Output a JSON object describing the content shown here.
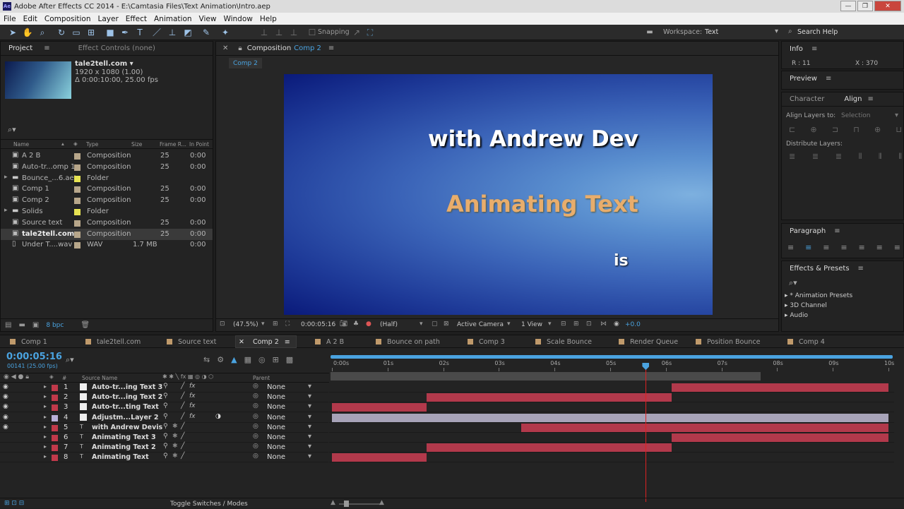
{
  "window": {
    "title": "Adobe After Effects CC 2014 - E:\\Camtasia Files\\Text Animation\\Intro.aep",
    "app_icon": "Ae"
  },
  "menu": [
    "File",
    "Edit",
    "Composition",
    "Layer",
    "Effect",
    "Animation",
    "View",
    "Window",
    "Help"
  ],
  "toolbar": {
    "snapping": "Snapping",
    "workspace_label": "Workspace:",
    "workspace_value": "Text",
    "search_placeholder": "Search Help"
  },
  "project": {
    "tab_project": "Project",
    "tab_effects": "Effect Controls (none)",
    "preview_name": "tale2tell.com ▾",
    "preview_res": "1920 x 1080 (1.00)",
    "preview_dur": "Δ 0:00:10:00, 25.00 fps",
    "columns": [
      "Name",
      "Type",
      "Size",
      "Frame R...",
      "In Point"
    ],
    "items": [
      {
        "name": "A 2 B",
        "type": "Composition",
        "size": "",
        "fr": "25",
        "in": "0:00",
        "color": "#b7a68a",
        "icon": "comp"
      },
      {
        "name": "Auto-tr...omp 1",
        "type": "Composition",
        "size": "",
        "fr": "25",
        "in": "0:00",
        "color": "#b7a68a",
        "icon": "comp"
      },
      {
        "name": "Bounce_...6.aet",
        "type": "Folder",
        "size": "",
        "fr": "",
        "in": "",
        "color": "#e7e353",
        "icon": "folder"
      },
      {
        "name": "Comp 1",
        "type": "Composition",
        "size": "",
        "fr": "25",
        "in": "0:00",
        "color": "#b7a68a",
        "icon": "comp"
      },
      {
        "name": "Comp 2",
        "type": "Composition",
        "size": "",
        "fr": "25",
        "in": "0:00",
        "color": "#b7a68a",
        "icon": "comp"
      },
      {
        "name": "Solids",
        "type": "Folder",
        "size": "",
        "fr": "",
        "in": "",
        "color": "#e7e353",
        "icon": "folder"
      },
      {
        "name": "Source text",
        "type": "Composition",
        "size": "",
        "fr": "25",
        "in": "0:00",
        "color": "#b7a68a",
        "icon": "comp"
      },
      {
        "name": "tale2tell.com",
        "type": "Composition",
        "size": "",
        "fr": "25",
        "in": "0:00",
        "color": "#b7a68a",
        "icon": "comp"
      },
      {
        "name": "Under T....wav",
        "type": "WAV",
        "size": "1.7 MB",
        "fr": "",
        "in": "0:00",
        "color": "#b7a68a",
        "icon": "audio"
      }
    ],
    "bpc": "8 bpc"
  },
  "composition": {
    "tab_label": "Composition",
    "tab_comp": "Comp 2",
    "sub_tab": "Comp 2",
    "text_line1": "with Andrew Dev",
    "text_line2": "Animating Text",
    "text_line3": "is",
    "zoom": "(47.5%)",
    "timecode": "0:00:05:16",
    "resolution": "(Half)",
    "camera": "Active Camera",
    "views": "1 View",
    "exposure": "+0.0"
  },
  "right_panels": {
    "info": "Info",
    "info_r": "R : 11",
    "info_x": "X : 370",
    "preview": "Preview",
    "character": "Character",
    "align": "Align",
    "align_to_label": "Align Layers to:",
    "align_to_value": "Selection",
    "distribute": "Distribute Layers:",
    "paragraph": "Paragraph",
    "effects": "Effects & Presets",
    "effects_items": [
      "* Animation Presets",
      "3D Channel",
      "Audio"
    ]
  },
  "timeline": {
    "tabs": [
      "Comp 1",
      "tale2tell.com",
      "Source text",
      "Comp 2",
      "A 2 B",
      "Bounce on path",
      "Comp 3",
      "Scale Bounce",
      "Render Queue",
      "Position Bounce",
      "Comp 4"
    ],
    "timecode": "0:00:05:16",
    "frames": "00141 (25.00 fps)",
    "source_col": "Source Name",
    "parent_col": "Parent",
    "ruler": [
      "0:00s",
      "01s",
      "02s",
      "03s",
      "04s",
      "05s",
      "06s",
      "07s",
      "08s",
      "09s",
      "10s"
    ],
    "playhead_s": 5.64,
    "work_area_end_s": 7.7,
    "layers": [
      {
        "num": "1",
        "name": "Auto-tr...ing Text 3",
        "color": "#c0394a",
        "parent": "None",
        "fx": true,
        "visible": true,
        "start": 6.1,
        "end": 10
      },
      {
        "num": "2",
        "name": "Auto-tr...ing Text 2",
        "color": "#c0394a",
        "parent": "None",
        "fx": true,
        "visible": true,
        "start": 1.7,
        "end": 6.1
      },
      {
        "num": "3",
        "name": "Auto-tr...ting Text",
        "color": "#c0394a",
        "parent": "None",
        "fx": true,
        "visible": true,
        "start": 0,
        "end": 1.7
      },
      {
        "num": "4",
        "name": "Adjustm...Layer 2",
        "color": "#b8b0d8",
        "parent": "None",
        "fx": true,
        "visible": true,
        "start": 0,
        "end": 10
      },
      {
        "num": "5",
        "name": "with Andrew Devis",
        "color": "#c0394a",
        "parent": "None",
        "fx": false,
        "visible": true,
        "start": 3.4,
        "end": 10
      },
      {
        "num": "6",
        "name": "Animating Text 3",
        "color": "#c0394a",
        "parent": "None",
        "fx": false,
        "visible": false,
        "start": 6.1,
        "end": 10
      },
      {
        "num": "7",
        "name": "Animating Text 2",
        "color": "#c0394a",
        "parent": "None",
        "fx": false,
        "visible": false,
        "start": 1.7,
        "end": 6.1
      },
      {
        "num": "8",
        "name": "Animating Text",
        "color": "#c0394a",
        "parent": "None",
        "fx": false,
        "visible": false,
        "start": 0,
        "end": 1.7
      }
    ],
    "toggle_label": "Toggle Switches / Modes"
  }
}
